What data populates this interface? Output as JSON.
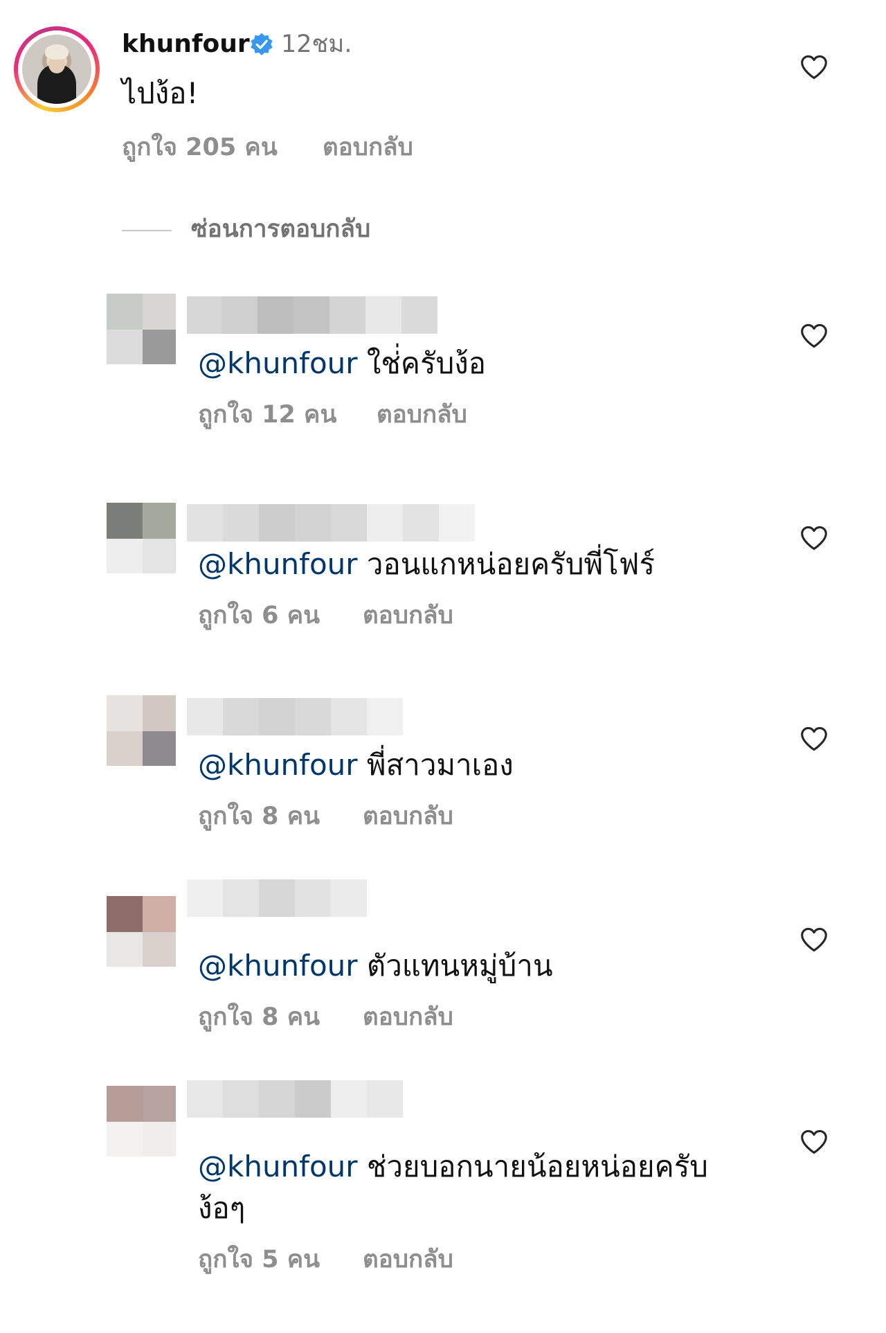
{
  "main_comment": {
    "username": "khunfour",
    "time": "12ชม.",
    "text": "ไปง้อ!",
    "likes": "ถูกใจ 205 คน",
    "reply_label": "ตอบกลับ",
    "verified_icon": "verified-badge-icon",
    "verified_color": "#3897f0"
  },
  "hide_replies_label": "ซ่อนการตอบกลับ",
  "replies": [
    {
      "mention": "@khunfour",
      "text": " ใช่่ครับง้อ",
      "likes": "ถูกใจ 12 คน",
      "reply_label": "ตอบกลับ"
    },
    {
      "mention": "@khunfour",
      "text": " วอนแกหน่อยครับพี่โฟร์",
      "likes": "ถูกใจ 6 คน",
      "reply_label": "ตอบกลับ"
    },
    {
      "mention": "@khunfour",
      "text": " พี่สาวมาเอง",
      "likes": "ถูกใจ 8 คน",
      "reply_label": "ตอบกลับ"
    },
    {
      "mention": "@khunfour",
      "text": " ตัวแทนหมู่บ้าน",
      "likes": "ถูกใจ 8 คน",
      "reply_label": "ตอบกลับ"
    },
    {
      "mention": "@khunfour",
      "text": " ช่วยบอกนายน้อยหน่อยครับ",
      "text_line2": "ง้อๆ",
      "likes": "ถูกใจ 5 คน",
      "reply_label": "ตอบกลับ"
    }
  ],
  "colors": {
    "mention": "#00376b",
    "secondary_text": "#8e8e8e",
    "primary_text": "#111111"
  }
}
